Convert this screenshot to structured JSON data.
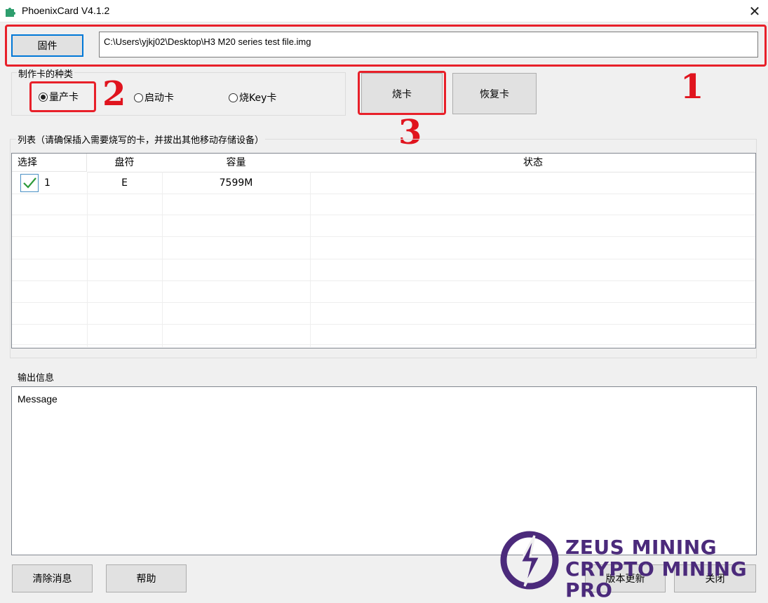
{
  "window": {
    "title": "PhoenixCard V4.1.2",
    "close_glyph": "✕"
  },
  "firmware": {
    "button_label": "固件",
    "path_value": "C:\\Users\\yjkj02\\Desktop\\H3 M20 series test file.img"
  },
  "card_type": {
    "group_label": "制作卡的种类",
    "options": [
      {
        "label": "量产卡",
        "selected": true
      },
      {
        "label": "启动卡",
        "selected": false
      },
      {
        "label": "烧Key卡",
        "selected": false
      }
    ]
  },
  "actions": {
    "burn_label": "烧卡",
    "restore_label": "恢复卡"
  },
  "list": {
    "group_label": "列表（请确保插入需要烧写的卡，并拔出其他移动存储设备）",
    "columns": [
      "选择",
      "盘符",
      "容量",
      "状态"
    ],
    "rows": [
      {
        "checked": true,
        "index": "1",
        "drive": "E",
        "capacity": "7599M",
        "status": ""
      }
    ]
  },
  "output": {
    "group_label": "输出信息",
    "message": "Message"
  },
  "bottom_buttons": {
    "clear_label": "清除消息",
    "help_label": "帮助",
    "update_label": "版本更新",
    "close_label": "关闭"
  },
  "annotations": {
    "step1": "1",
    "step2": "2",
    "step3": "3",
    "color": "#e8202a"
  },
  "watermark": {
    "line1": "ZEUS MINING",
    "line2": "CRYPTO MINING PRO",
    "color": "#4b2a7b"
  },
  "icons": {
    "app": "app-puzzle-icon",
    "close": "close-icon",
    "check": "check-icon",
    "logo": "lightning-logo-icon"
  }
}
